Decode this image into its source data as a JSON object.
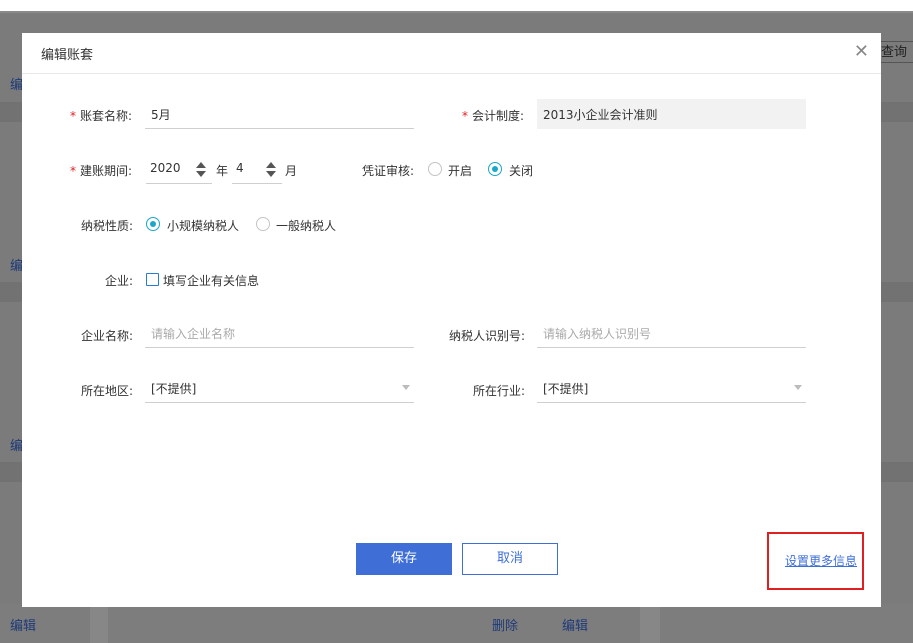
{
  "background": {
    "query_button_label": "查询",
    "row_links": [
      "编",
      "编",
      "编"
    ],
    "bottom_links": {
      "left_edit": "编辑",
      "delete": "删除",
      "edit": "编辑"
    }
  },
  "dialog": {
    "title": "编辑账套",
    "close_icon": "close-icon",
    "account_name": {
      "label": "账套名称:",
      "value": "5月"
    },
    "accounting_system": {
      "label": "会计制度:",
      "value": "2013小企业会计准则"
    },
    "period": {
      "label": "建账期间:",
      "year": "2020",
      "year_unit": "年",
      "month": "4",
      "month_unit": "月"
    },
    "voucher_review": {
      "label": "凭证审核:",
      "options": [
        "开启",
        "关闭"
      ],
      "selected": "关闭"
    },
    "taxpayer_type": {
      "label": "纳税性质:",
      "options": [
        "小规模纳税人",
        "一般纳税人"
      ],
      "selected": "小规模纳税人"
    },
    "enterprise": {
      "label": "企业:",
      "checkbox_label": "填写企业有关信息",
      "checked": false
    },
    "enterprise_name": {
      "label": "企业名称:",
      "placeholder": "请输入企业名称"
    },
    "taxpayer_id": {
      "label": "纳税人识别号:",
      "placeholder": "请输入纳税人识别号"
    },
    "region": {
      "label": "所在地区:",
      "value": "[不提供]"
    },
    "industry": {
      "label": "所在行业:",
      "value": "[不提供]"
    },
    "save_label": "保存",
    "cancel_label": "取消",
    "more_info_link": "设置更多信息",
    "colors": {
      "primary": "#3f6fd6",
      "required": "#e02020",
      "radio": "#1aa7c8",
      "highlight": "#e02020"
    }
  }
}
